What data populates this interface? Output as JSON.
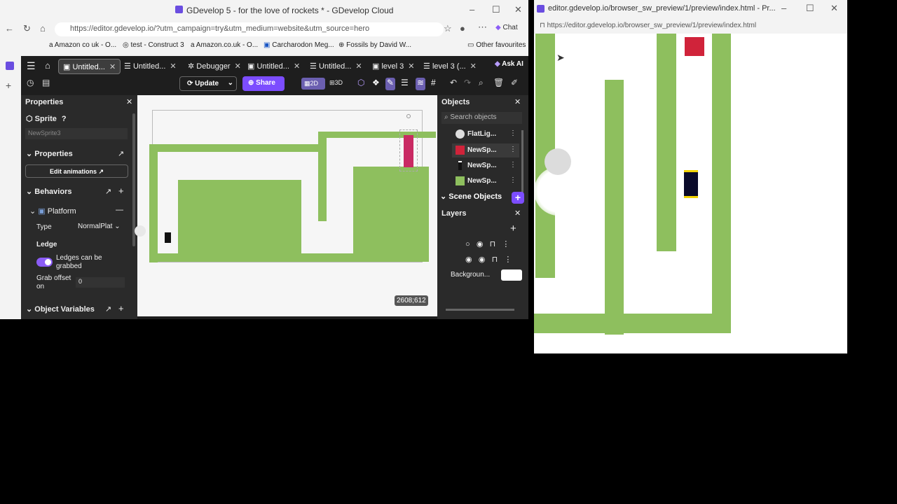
{
  "left_window": {
    "title": "GDevelop 5 - for the love of rockets * - GDevelop Cloud",
    "url": "https://editor.gdevelop.io/?utm_campaign=try&utm_medium=website&utm_source=hero",
    "bookmarks": [
      "Amazon co uk - O...",
      "test - Construct 3",
      "Amazon.co.uk - O...",
      "Carcharodon Meg...",
      "Fossils by David W...",
      "Other favourites"
    ],
    "browser_chat": "Chat",
    "tabs": [
      {
        "label": "Untitled..."
      },
      {
        "label": "Untitled..."
      },
      {
        "label": "Debugger"
      },
      {
        "label": "Untitled..."
      },
      {
        "label": "Untitled..."
      },
      {
        "label": "level 3"
      },
      {
        "label": "level 3 (..."
      }
    ],
    "ask_ai": "Ask AI",
    "toolbar": {
      "update": "Update",
      "share": "Share",
      "mode_2d": "2D",
      "mode_3d": "3D"
    },
    "properties": {
      "header": "Properties",
      "type_label": "Sprite",
      "name_placeholder": "NewSprite3",
      "section_properties": "Properties",
      "edit_animations": "Edit animations",
      "behaviors": "Behaviors",
      "platform": "Platform",
      "type_field": "Type",
      "type_value": "NormalPlat",
      "ledge": "Ledge",
      "ledge_grab_label": "Ledges can be grabbed",
      "grab_offset_label": "Grab offset on",
      "grab_offset_value": "0",
      "object_variables": "Object Variables"
    },
    "canvas": {
      "coords": "2608;612"
    },
    "objects": {
      "header": "Objects",
      "search_placeholder": "Search objects",
      "items": [
        {
          "name": "FlatLig...",
          "color": "#dddddd"
        },
        {
          "name": "NewSp...",
          "color": "#d0233a"
        },
        {
          "name": "NewSp...",
          "color": "#111111"
        },
        {
          "name": "NewSp...",
          "color": "#8ebf5e"
        }
      ],
      "scene_objects": "Scene Objects"
    },
    "layers": {
      "header": "Layers",
      "background": "Backgroun..."
    }
  },
  "right_window": {
    "title": "editor.gdevelop.io/browser_sw_preview/1/preview/index.html - Pr...",
    "url": "https://editor.gdevelop.io/browser_sw_preview/1/preview/index.html"
  },
  "colors": {
    "platform": "#8ebf5e",
    "accent": "#8b5cf6",
    "red": "#d0233a"
  }
}
